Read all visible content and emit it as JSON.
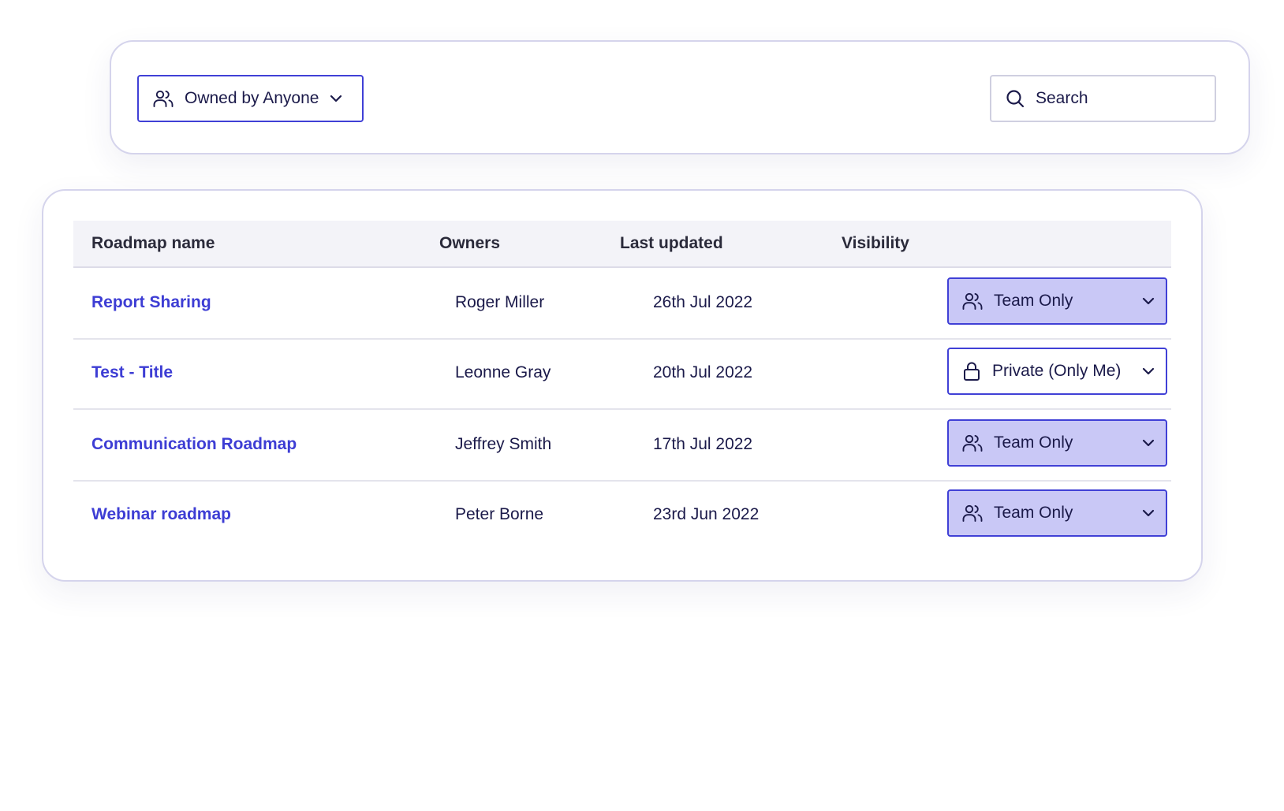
{
  "filter_bar": {
    "owner_filter": {
      "label": "Owned by Anyone",
      "icon": "users-icon"
    },
    "search": {
      "placeholder": "Search",
      "value": "",
      "icon": "search-icon"
    }
  },
  "table": {
    "columns": [
      "Roadmap name",
      "Owners",
      "Last updated",
      "Visibility"
    ],
    "rows": [
      {
        "name": "Report Sharing",
        "owner": "Roger Miller",
        "updated": "26th Jul 2022",
        "visibility": "Team Only",
        "visibility_icon": "users-icon"
      },
      {
        "name": "Test - Title",
        "owner": "Leonne Gray",
        "updated": "20th Jul 2022",
        "visibility": "Private (Only Me)",
        "visibility_icon": "lock-icon"
      },
      {
        "name": "Communication Roadmap",
        "owner": "Jeffrey Smith",
        "updated": "17th Jul 2022",
        "visibility": "Team Only",
        "visibility_icon": "users-icon"
      },
      {
        "name": "Webinar roadmap",
        "owner": "Peter Borne",
        "updated": "23rd Jun 2022",
        "visibility": "Team Only",
        "visibility_icon": "users-icon"
      }
    ]
  },
  "colors": {
    "accent": "#4040d6",
    "link": "#3d3dd4",
    "team_badge_bg": "#c9c8f6",
    "text": "#1b1a4a",
    "card_border": "#d5d4ec"
  }
}
